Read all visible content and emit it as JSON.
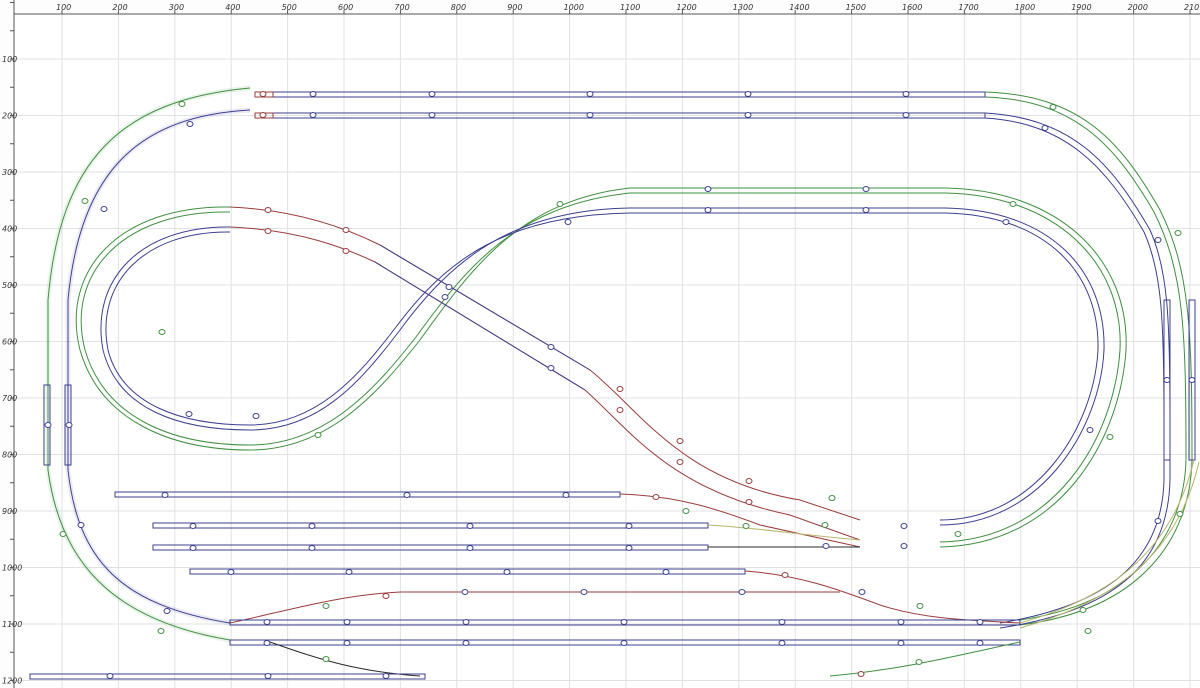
{
  "planner": {
    "x_ticks": [
      "100",
      "200",
      "300",
      "400",
      "500",
      "600",
      "700",
      "800",
      "900",
      "1000",
      "1100",
      "1200",
      "1300",
      "1400",
      "1500",
      "1600",
      "1700",
      "1800",
      "1900",
      "2000",
      "210"
    ],
    "y_ticks": [
      "100",
      "200",
      "300",
      "400",
      "500",
      "600",
      "700",
      "800",
      "900",
      "1000",
      "1100",
      "1200"
    ]
  },
  "colors": {
    "main_track": "#3b3f8f",
    "outer_track": "#3f8f3f",
    "turnout_track": "#9a3b3b",
    "flex_track": "#b8b66a",
    "grid": "#e0e2e6"
  }
}
